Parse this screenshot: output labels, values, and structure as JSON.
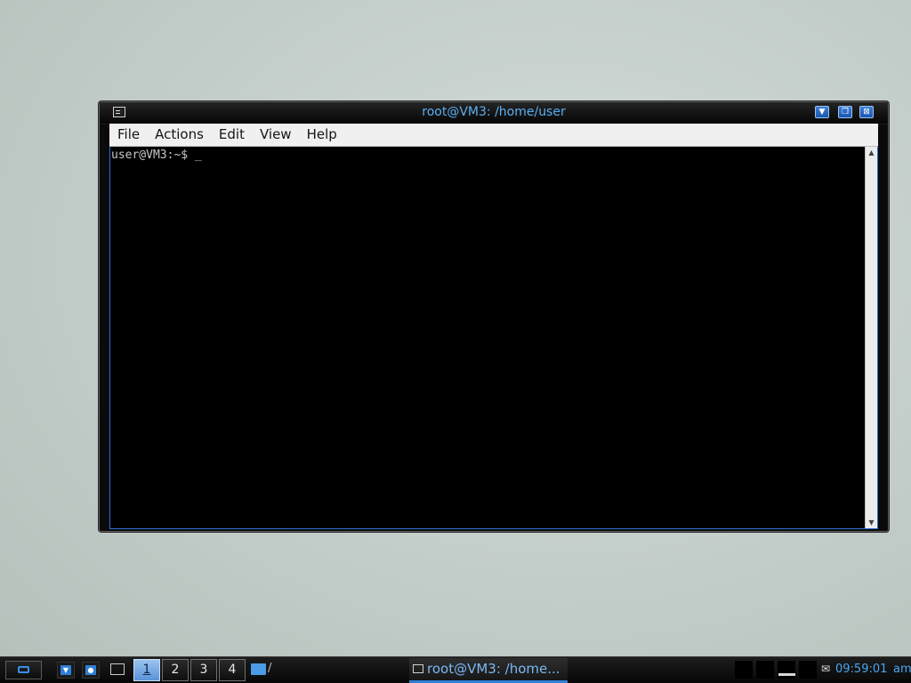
{
  "window": {
    "title": "root@VM3: /home/user",
    "menu": [
      "File",
      "Actions",
      "Edit",
      "View",
      "Help"
    ],
    "terminal_text": "user@VM3:~$ _",
    "buttons": {
      "minimize_icon": "triangle-down-icon",
      "maximize_icon": "restore-icon",
      "close_icon": "close-icon"
    },
    "colors": {
      "title": "#5aaef0",
      "frame_accent": "#2c6fd2"
    }
  },
  "taskbar": {
    "desktops": [
      "1",
      "2",
      "3",
      "4"
    ],
    "active_desktop": "1",
    "folder_label": "/",
    "task_label": "root@VM3: /home...",
    "clock": "09:59:01",
    "clock_suffix": "am",
    "colors": {
      "accent": "#4aa6ef"
    }
  }
}
